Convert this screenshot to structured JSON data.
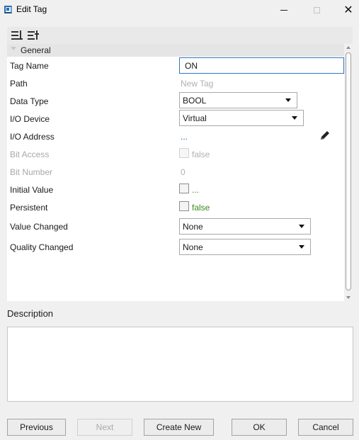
{
  "window": {
    "title": "Edit Tag",
    "close_glyph": "✕"
  },
  "toolbar": {
    "icons": [
      "sort-categorized-icon",
      "sort-alphabetical-icon"
    ]
  },
  "grid": {
    "category": "General",
    "rows": {
      "tag_name": {
        "label": "Tag Name",
        "value": "ON"
      },
      "path": {
        "label": "Path",
        "value": "New Tag"
      },
      "data_type": {
        "label": "Data Type",
        "value": "BOOL"
      },
      "io_device": {
        "label": "I/O Device",
        "value": "Virtual"
      },
      "io_address": {
        "label": "I/O Address",
        "value": "..."
      },
      "bit_access": {
        "label": "Bit Access",
        "value": "false"
      },
      "bit_number": {
        "label": "Bit Number",
        "value": "0"
      },
      "initial_value": {
        "label": "Initial Value",
        "value": "..."
      },
      "persistent": {
        "label": "Persistent",
        "value": "false"
      },
      "value_changed": {
        "label": "Value Changed",
        "value": "None"
      },
      "quality_changed": {
        "label": "Quality Changed",
        "value": "None"
      }
    }
  },
  "description": {
    "label": "Description",
    "value": ""
  },
  "buttons": {
    "previous": "Previous",
    "next": "Next",
    "create_new": "Create New",
    "ok": "OK",
    "cancel": "Cancel"
  },
  "colors": {
    "accent": "#2b78c6",
    "value_green": "#3a8a1e",
    "link_blue": "#2063c7",
    "disabled_gray": "#a8a8a8"
  }
}
